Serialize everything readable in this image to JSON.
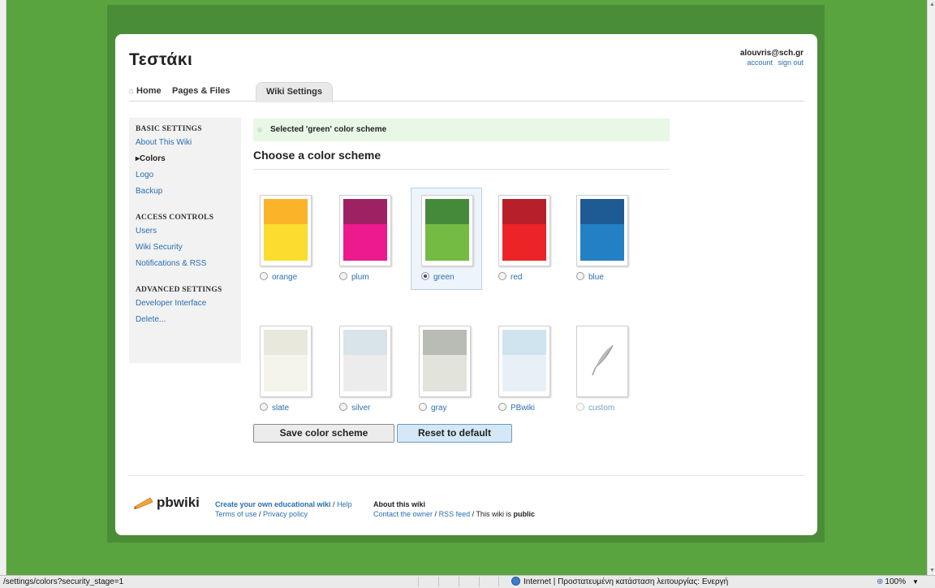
{
  "wiki": {
    "title": "Τεστάκι"
  },
  "user": {
    "email": "alouvris@sch.gr",
    "account": "account",
    "signout": "sign out"
  },
  "tabs": {
    "home": "Home",
    "pages": "Pages & Files",
    "settings": "Wiki Settings"
  },
  "sidebar": {
    "basic": {
      "heading": "BASIC SETTINGS",
      "items": [
        "About This Wiki",
        "Colors",
        "Logo",
        "Backup"
      ]
    },
    "access": {
      "heading": "ACCESS CONTROLS",
      "items": [
        "Users",
        "Wiki Security",
        "Notifications & RSS"
      ]
    },
    "advanced": {
      "heading": "ADVANCED SETTINGS",
      "items": [
        "Developer Interface",
        "Delete..."
      ]
    }
  },
  "flash": {
    "message": "Selected 'green' color scheme"
  },
  "main": {
    "title": "Choose a color scheme"
  },
  "schemes": [
    {
      "label": "orange",
      "top": "#fbb42a",
      "bottom": "#fcdc2e",
      "selected": false
    },
    {
      "label": "plum",
      "top": "#9e2263",
      "bottom": "#ec1a8c",
      "selected": false
    },
    {
      "label": "green",
      "top": "#458a3b",
      "bottom": "#73bb43",
      "selected": true
    },
    {
      "label": "red",
      "top": "#b7202a",
      "bottom": "#ec2327",
      "selected": false
    },
    {
      "label": "blue",
      "top": "#1e5b94",
      "bottom": "#2480c4",
      "selected": false
    },
    {
      "label": "slate",
      "top": "#e9e8dd",
      "bottom": "#f4f4ea",
      "selected": false
    },
    {
      "label": "silver",
      "top": "#d8e3ea",
      "bottom": "#ececec",
      "selected": false
    },
    {
      "label": "gray",
      "top": "#b9bcb4",
      "bottom": "#e2e3da",
      "selected": false
    },
    {
      "label": "PBwiki",
      "top": "#cfe4ee",
      "bottom": "#e6f0f6",
      "selected": false
    },
    {
      "label": "custom",
      "selected": false,
      "disabled": true
    }
  ],
  "buttons": {
    "save": "Save color scheme",
    "reset": "Reset to default"
  },
  "footer": {
    "logo": "pbwiki",
    "create": "Create your own educational wiki",
    "help": "Help",
    "terms": "Terms of use",
    "privacy": "Privacy policy",
    "about_heading": "About this wiki",
    "contact": "Contact the owner",
    "rss": "RSS feed",
    "public_prefix": "This wiki is",
    "public_word": "public"
  },
  "statusbar": {
    "url": "/settings/colors?security_stage=1",
    "zone": "Internet | Προστατευμένη κατάσταση λειτουργίας: Ενεργή",
    "zoom": "100%"
  }
}
